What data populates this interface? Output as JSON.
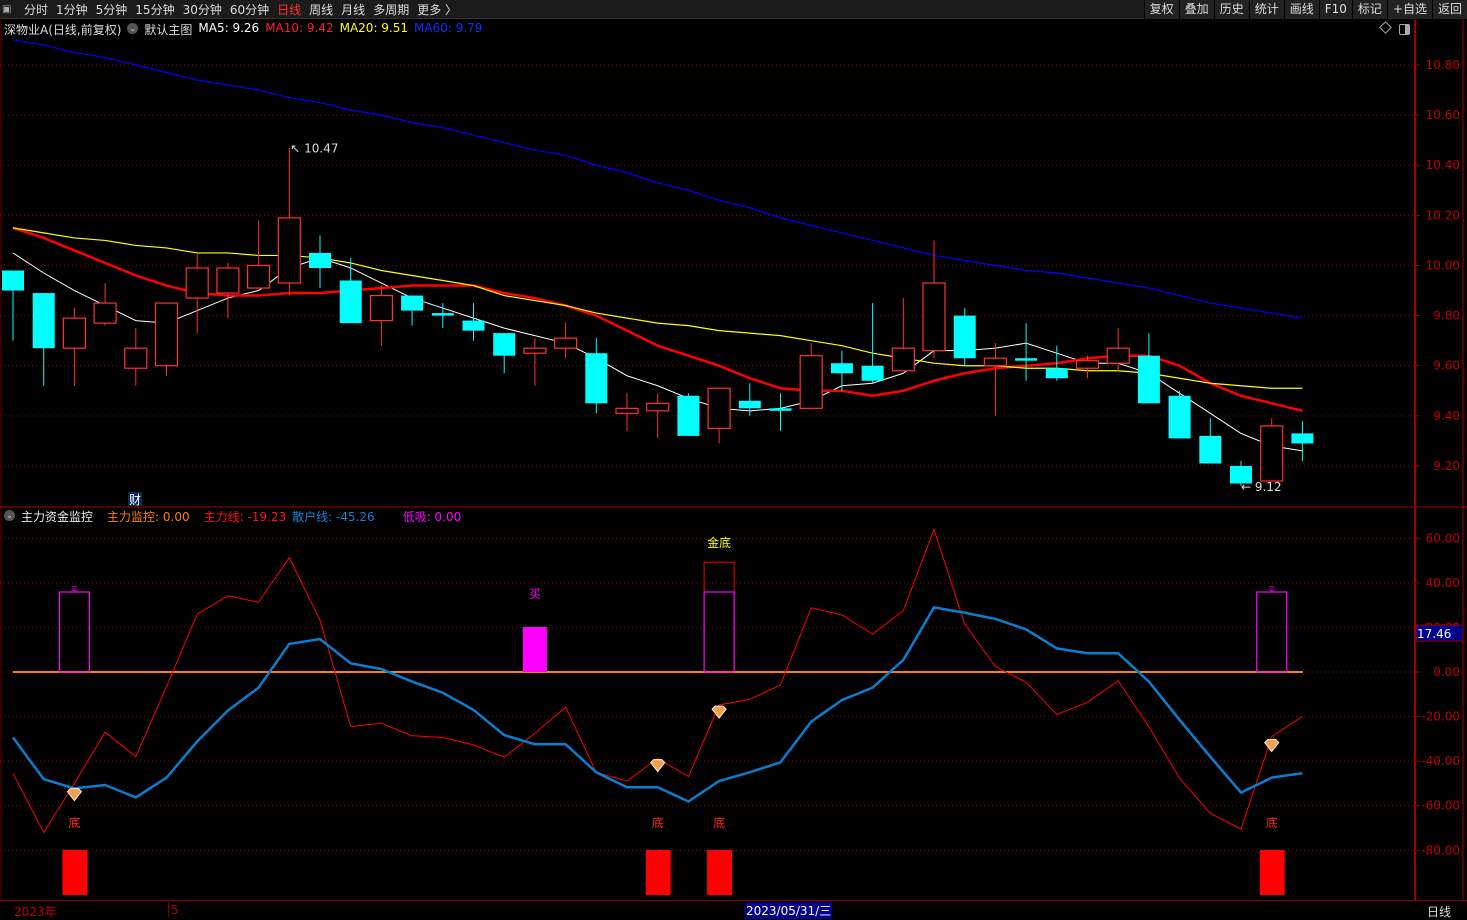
{
  "toolbar": {
    "tabs": [
      "分时",
      "1分钟",
      "5分钟",
      "15分钟",
      "30分钟",
      "60分钟",
      "日线",
      "周线",
      "月线",
      "多周期",
      "更多 〉"
    ],
    "active_tab": "日线",
    "buttons": [
      "复权",
      "叠加",
      "历史",
      "统计",
      "画线",
      "F10",
      "标记",
      "+自选",
      "返回"
    ]
  },
  "legend": {
    "stock": "深物业A(日线,前复权)",
    "template": "默认主图",
    "ma5": "MA5: 9.26",
    "ma10": "MA10: 9.42",
    "ma20": "MA20: 9.51",
    "ma60": "MA60: 9.79"
  },
  "indicator_legend": {
    "name": "主力资金监控",
    "monitor": "主力监控: 0.00",
    "main": "主力线: -19.23",
    "retail": "散户线: -45.26",
    "low": "低吸: 0.00"
  },
  "colors": {
    "up": "#ff3232",
    "down": "#00ffff",
    "ma5": "#ffffff",
    "ma10": "#ff0000",
    "ma20": "#ffff00",
    "ma60": "#0000ff",
    "main": "#ff0000",
    "retail": "#0a7fd0",
    "zero": "#ff8000",
    "grid": "#8b0000",
    "highlight": "#00008b"
  },
  "bottom_axis": {
    "year": "2023年",
    "month": "5",
    "cursor_date": "2023/05/31/三",
    "period": "日线"
  },
  "cai_label": "财",
  "chart_data": [
    {
      "type": "candlestick",
      "title": "深物业A",
      "price_ticks": [
        10.8,
        10.6,
        10.4,
        10.2,
        10.0,
        9.8,
        9.6,
        9.4,
        9.2
      ],
      "ylim": [
        9.12,
        10.9
      ],
      "candles": [
        [
          9.98,
          9.98,
          9.7,
          9.9
        ],
        [
          9.89,
          9.89,
          9.52,
          9.67
        ],
        [
          9.67,
          9.83,
          9.52,
          9.79
        ],
        [
          9.77,
          9.93,
          9.76,
          9.85
        ],
        [
          9.59,
          9.75,
          9.52,
          9.67
        ],
        [
          9.6,
          9.85,
          9.56,
          9.85
        ],
        [
          9.87,
          10.05,
          9.73,
          9.99
        ],
        [
          9.89,
          10.01,
          9.79,
          9.99
        ],
        [
          9.91,
          10.18,
          9.91,
          10.0
        ],
        [
          9.93,
          10.47,
          9.88,
          10.19
        ],
        [
          10.05,
          10.12,
          9.91,
          9.99
        ],
        [
          9.94,
          10.03,
          9.77,
          9.77
        ],
        [
          9.78,
          9.92,
          9.68,
          9.88
        ],
        [
          9.88,
          9.88,
          9.76,
          9.82
        ],
        [
          9.81,
          9.85,
          9.75,
          9.8
        ],
        [
          9.78,
          9.85,
          9.7,
          9.74
        ],
        [
          9.73,
          9.73,
          9.57,
          9.64
        ],
        [
          9.65,
          9.71,
          9.52,
          9.67
        ],
        [
          9.67,
          9.77,
          9.63,
          9.71
        ],
        [
          9.65,
          9.71,
          9.41,
          9.45
        ],
        [
          9.41,
          9.49,
          9.34,
          9.43
        ],
        [
          9.42,
          9.49,
          9.31,
          9.45
        ],
        [
          9.48,
          9.49,
          9.32,
          9.32
        ],
        [
          9.35,
          9.51,
          9.29,
          9.51
        ],
        [
          9.46,
          9.53,
          9.4,
          9.43
        ],
        [
          9.43,
          9.49,
          9.34,
          9.42
        ],
        [
          9.43,
          9.69,
          9.43,
          9.64
        ],
        [
          9.61,
          9.66,
          9.5,
          9.57
        ],
        [
          9.6,
          9.85,
          9.53,
          9.54
        ],
        [
          9.58,
          9.87,
          9.58,
          9.67
        ],
        [
          9.66,
          10.1,
          9.63,
          9.93
        ],
        [
          9.8,
          9.83,
          9.6,
          9.63
        ],
        [
          9.6,
          9.69,
          9.4,
          9.63
        ],
        [
          9.63,
          9.77,
          9.54,
          9.62
        ],
        [
          9.59,
          9.68,
          9.54,
          9.55
        ],
        [
          9.59,
          9.64,
          9.55,
          9.62
        ],
        [
          9.61,
          9.75,
          9.58,
          9.67
        ],
        [
          9.64,
          9.73,
          9.45,
          9.45
        ],
        [
          9.48,
          9.5,
          9.31,
          9.31
        ],
        [
          9.32,
          9.39,
          9.21,
          9.21
        ],
        [
          9.2,
          9.22,
          9.12,
          9.13
        ],
        [
          9.14,
          9.39,
          9.14,
          9.36
        ],
        [
          9.33,
          9.38,
          9.22,
          9.29
        ]
      ],
      "candle_format": [
        "open",
        "high",
        "low",
        "close"
      ],
      "high_label": "10.47",
      "low_label": "9.12",
      "high_index": 9,
      "low_index": 40,
      "series": [
        {
          "name": "MA5",
          "values": [
            10.05,
            9.97,
            9.9,
            9.84,
            9.78,
            9.77,
            9.82,
            9.87,
            9.9,
            9.99,
            10.03,
            9.99,
            9.93,
            9.87,
            9.83,
            9.79,
            9.75,
            9.72,
            9.69,
            9.63,
            9.56,
            9.52,
            9.47,
            9.43,
            9.42,
            9.43,
            9.46,
            9.52,
            9.53,
            9.57,
            9.66,
            9.66,
            9.67,
            9.69,
            9.65,
            9.61,
            9.61,
            9.57,
            9.49,
            9.41,
            9.33,
            9.28,
            9.26
          ]
        },
        {
          "name": "MA10",
          "values": [
            10.15,
            10.11,
            10.06,
            10.01,
            9.96,
            9.92,
            9.89,
            9.88,
            9.88,
            9.89,
            9.89,
            9.9,
            9.91,
            9.92,
            9.92,
            9.92,
            9.89,
            9.87,
            9.84,
            9.8,
            9.74,
            9.68,
            9.64,
            9.6,
            9.55,
            9.51,
            9.5,
            9.5,
            9.48,
            9.5,
            9.54,
            9.57,
            9.59,
            9.6,
            9.61,
            9.63,
            9.64,
            9.64,
            9.6,
            9.53,
            9.48,
            9.45,
            9.42
          ]
        },
        {
          "name": "MA20",
          "values": [
            10.15,
            10.13,
            10.11,
            10.1,
            10.08,
            10.07,
            10.05,
            10.05,
            10.04,
            10.04,
            10.03,
            10.01,
            9.98,
            9.96,
            9.94,
            9.92,
            9.88,
            9.86,
            9.84,
            9.81,
            9.79,
            9.77,
            9.76,
            9.74,
            9.73,
            9.72,
            9.7,
            9.68,
            9.65,
            9.63,
            9.61,
            9.6,
            9.6,
            9.59,
            9.59,
            9.58,
            9.58,
            9.57,
            9.55,
            9.53,
            9.52,
            9.51,
            9.51
          ]
        },
        {
          "name": "MA60",
          "values": [
            10.9,
            10.88,
            10.85,
            10.83,
            10.8,
            10.77,
            10.74,
            10.72,
            10.7,
            10.67,
            10.65,
            10.62,
            10.6,
            10.57,
            10.55,
            10.52,
            10.49,
            10.46,
            10.44,
            10.4,
            10.37,
            10.33,
            10.3,
            10.26,
            10.23,
            10.19,
            10.16,
            10.13,
            10.1,
            10.07,
            10.04,
            10.02,
            10.0,
            9.98,
            9.97,
            9.95,
            9.93,
            9.91,
            9.88,
            9.85,
            9.83,
            9.81,
            9.79
          ]
        }
      ]
    },
    {
      "type": "line",
      "title": "主力资金监控",
      "ticks": [
        60,
        40,
        20,
        0,
        -20,
        -40,
        -60,
        -80
      ],
      "ylim": [
        -90,
        65
      ],
      "cursor_value": "17.46",
      "series": [
        {
          "name": "主力线",
          "values": [
            -45.4,
            -72.0,
            -49.9,
            -27.0,
            -38.0,
            -6.6,
            26.0,
            34.2,
            31.3,
            51.3,
            23.3,
            -24.5,
            -23.0,
            -28.6,
            -29.4,
            -32.7,
            -38.3,
            -27.5,
            -15.8,
            -45.1,
            -48.9,
            -38.8,
            -46.9,
            -14.8,
            -12.3,
            -5.8,
            28.8,
            25.6,
            17.0,
            27.5,
            64.0,
            21.5,
            2.4,
            -4.6,
            -19.0,
            -13.6,
            -3.9,
            -24.5,
            -47.7,
            -63.4,
            -70.5,
            -29.0,
            -20.0
          ]
        },
        {
          "name": "散户线",
          "values": [
            -29.4,
            -48.1,
            -52.2,
            -50.7,
            -56.3,
            -47.4,
            -31.2,
            -17.3,
            -7.0,
            12.6,
            14.8,
            3.9,
            1.3,
            -4.3,
            -9.3,
            -17.0,
            -28.3,
            -32.4,
            -32.4,
            -45.0,
            -51.7,
            -51.7,
            -58.1,
            -48.9,
            -45.0,
            -40.5,
            -22.3,
            -12.6,
            -7.0,
            5.4,
            29.0,
            26.6,
            23.8,
            19.1,
            10.6,
            8.4,
            8.4,
            -4.3,
            -21.5,
            -38.0,
            -54.1,
            -47.4,
            -45.4
          ]
        }
      ],
      "monitor_bars": [
        {
          "index": 2,
          "value": 35.9
        },
        {
          "index": 23,
          "value": 35.9,
          "outer": 49.3
        },
        {
          "index": 41,
          "value": 35.9
        }
      ],
      "low_buy_bars": [
        {
          "index": 17,
          "value": 20.2
        }
      ],
      "buy_label": "买",
      "buy_indices": [
        2,
        17,
        41
      ],
      "gold_bottom_label": "金底",
      "gold_bottom_index": 23,
      "bottom_label": "底",
      "bottom_indices": [
        2,
        21,
        23,
        41
      ],
      "diamond_points": [
        {
          "index": 2,
          "value": -55
        },
        {
          "index": 21,
          "value": -42
        },
        {
          "index": 23,
          "value": -18
        },
        {
          "index": 41,
          "value": -33
        }
      ]
    }
  ]
}
